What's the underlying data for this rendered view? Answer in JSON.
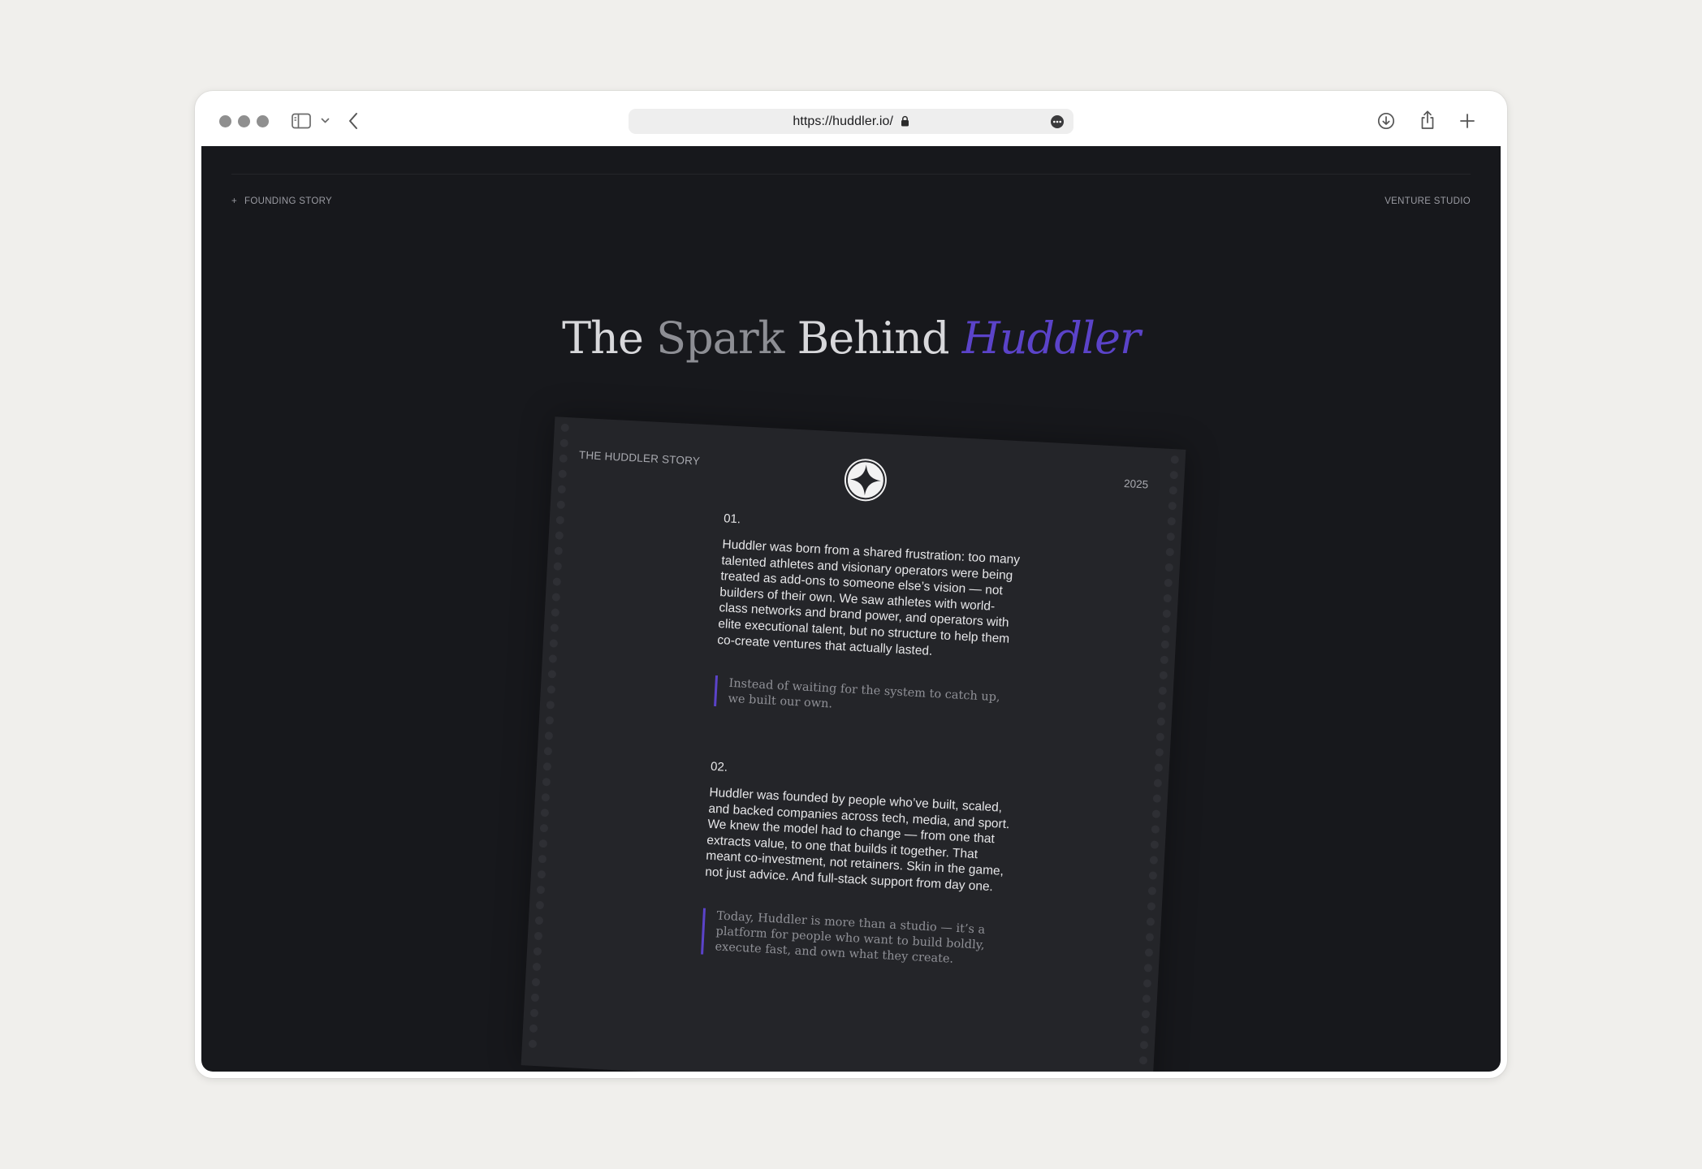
{
  "browser": {
    "url": "https://huddler.io/",
    "icons": {
      "sidebar": "sidebar-icon",
      "chevron": "chevron-down-icon",
      "back": "chevron-left-icon",
      "lock": "lock-icon",
      "more": "ellipsis-circle-icon",
      "download": "download-icon",
      "share": "share-icon",
      "new_tab": "plus-icon"
    }
  },
  "page": {
    "meta_left": "FOUNDING STORY",
    "meta_right": "VENTURE STUDIO",
    "title_words": [
      "The",
      "Spark",
      "Behind",
      "Huddler"
    ],
    "colors": {
      "accent": "#5b43c9",
      "background": "#17181c",
      "card": "#242529"
    }
  },
  "card": {
    "label": "THE HUDDLER STORY",
    "year": "2025",
    "logo": "four-point-star-logo",
    "sections": [
      {
        "num": "01.",
        "text": "Huddler was born from a shared frustration: too many talented athletes and visionary operators were being treated as add-ons to someone else’s vision — not builders of their own. We saw athletes with world-class networks and brand power, and operators with elite executional talent, but no structure to help them co-create ventures that actually lasted.",
        "quote": "Instead of waiting for the system to catch up, we built our own."
      },
      {
        "num": "02.",
        "text": "Huddler was founded by people who’ve built, scaled, and backed companies across tech, media, and sport. We knew the model had to change — from one that extracts value, to one that builds it together. That meant co-investment, not retainers. Skin in the game, not just advice. And full-stack support from day one.",
        "quote": "Today, Huddler is more than a studio — it’s a platform for people who want to build boldly, execute fast, and own what they create."
      }
    ]
  }
}
